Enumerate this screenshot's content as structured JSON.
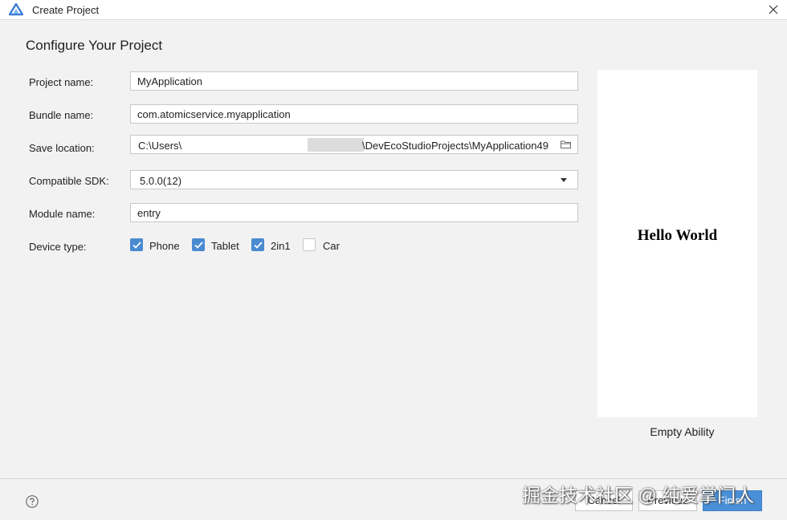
{
  "window": {
    "title": "Create Project",
    "app_icon": "deveco-logo-icon",
    "close_icon": "close-icon"
  },
  "heading": "Configure Your Project",
  "form": {
    "project_name": {
      "label": "Project name:",
      "value": "MyApplication"
    },
    "bundle_name": {
      "label": "Bundle name:",
      "value": "com.atomicservice.myapplication"
    },
    "save_location": {
      "label": "Save location:",
      "value_prefix": "C:\\Users\\",
      "value_suffix": "\\DevEcoStudioProjects\\MyApplication49",
      "browse_icon": "folder-icon"
    },
    "compatible_sdk": {
      "label": "Compatible SDK:",
      "value": "5.0.0(12)"
    },
    "module_name": {
      "label": "Module name:",
      "value": "entry"
    },
    "device_type": {
      "label": "Device type:",
      "options": [
        {
          "label": "Phone",
          "checked": true
        },
        {
          "label": "Tablet",
          "checked": true
        },
        {
          "label": "2in1",
          "checked": true
        },
        {
          "label": "Car",
          "checked": false
        }
      ]
    }
  },
  "preview": {
    "text": "Hello World",
    "template_name": "Empty Ability"
  },
  "footer": {
    "help_icon": "help-icon",
    "cancel_label": "Cancel",
    "previous_label": "Previous",
    "finish_label": "Finish"
  },
  "watermark": "掘金技术社区 @ 纯爱掌门人",
  "colors": {
    "accent": "#4a8ad1",
    "primary_button": "#4a90d9",
    "background": "#f2f2f2"
  }
}
